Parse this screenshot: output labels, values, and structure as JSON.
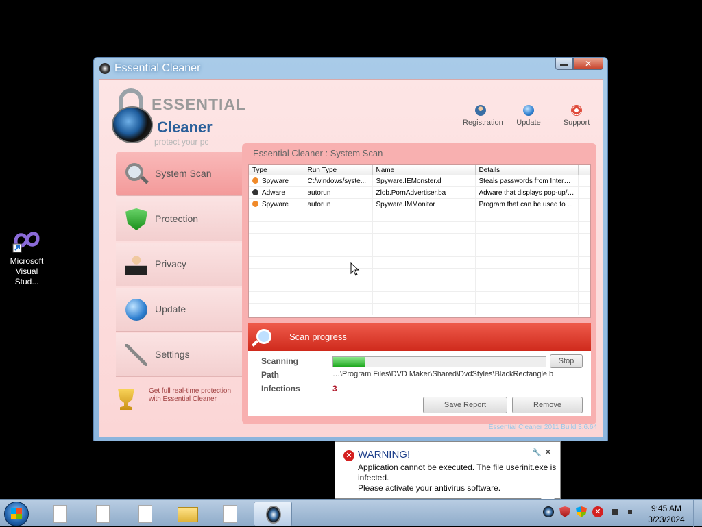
{
  "desktop": {
    "icon_label": "Microsoft Visual Stud..."
  },
  "window": {
    "title": "Essential Cleaner",
    "minimize": "▬",
    "close": "✕",
    "logo": {
      "line1": "ESSENTIAL",
      "line2": "Cleaner",
      "tagline": "protect your pc"
    },
    "top_links": [
      {
        "label": "Registration",
        "icon": "registration-icon"
      },
      {
        "label": "Update",
        "icon": "globe-icon"
      },
      {
        "label": "Support",
        "icon": "lifebuoy-icon"
      }
    ],
    "nav": [
      {
        "label": "System Scan",
        "icon": "magnifier-icon",
        "active": true
      },
      {
        "label": "Protection",
        "icon": "shield-check-icon"
      },
      {
        "label": "Privacy",
        "icon": "spy-icon"
      },
      {
        "label": "Update",
        "icon": "globe-icon"
      },
      {
        "label": "Settings",
        "icon": "wrench-icon"
      }
    ],
    "promo": "Get full real-time protection with Essential Cleaner",
    "panel_title": "Essential Cleaner : System Scan",
    "table": {
      "headers": [
        "Type",
        "Run Type",
        "Name",
        "Details"
      ],
      "rows": [
        {
          "type": "Spyware",
          "run_type": "C:/windows/syste...",
          "name": "Spyware.IEMonster.d",
          "details": "Steals passwords from Interne...",
          "dot": "#f08a2a"
        },
        {
          "type": "Adware",
          "run_type": "autorun",
          "name": "Zlob.PornAdvertiser.ba",
          "details": "Adware that displays pop-up/p...",
          "dot": "#333333"
        },
        {
          "type": "Spyware",
          "run_type": "autorun",
          "name": "Spyware.IMMonitor",
          "details": "Program that can be used to ...",
          "dot": "#f08a2a"
        }
      ]
    },
    "progress": {
      "heading": "Scan progress",
      "scanning_label": "Scanning",
      "path_label": "Path",
      "infections_label": "Infections",
      "path_value": "…\\Program Files\\DVD Maker\\Shared\\DvdStyles\\BlackRectangle.b",
      "infections_value": "3",
      "fraction": 0.15,
      "stop_label": "Stop",
      "save_label": "Save Report",
      "remove_label": "Remove"
    },
    "build": "Essential Cleaner 2011 Build 3.6.64"
  },
  "notification": {
    "title": "WARNING!",
    "line1": "Application cannot be executed. The file userinit.exe is infected.",
    "line2": "Please activate your antivirus software.",
    "pin": "🔧",
    "close": "✕"
  },
  "taskbar": {
    "time": "9:45 AM",
    "date": "3/23/2024"
  },
  "colors": {
    "accent": "#cf2a1c",
    "panel": "#f8b0b0",
    "titlebar": "#a9cbe8"
  }
}
